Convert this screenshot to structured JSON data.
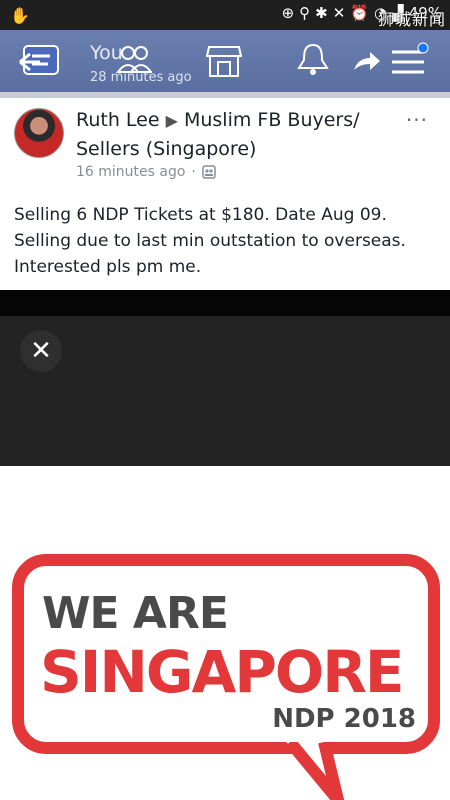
{
  "statusbar": {
    "battery": "49%",
    "watermark": "狮城新闻"
  },
  "topbar": {
    "title": "You",
    "subtitle": "28 minutes ago"
  },
  "post": {
    "author": "Ruth Lee",
    "group": "Muslim FB Buyers/ Sellers (Singapore)",
    "time": "16 minutes ago",
    "more": "···",
    "text": "Selling 6 NDP Tickets at $180. Date Aug 09. Selling due to last min outstation to overseas. Interested pls pm me."
  },
  "banner": {
    "line1": "WE ARE",
    "line2": "SINGAPORE",
    "line3": "NDP 2018"
  },
  "colors": {
    "fb_blue": "#5a6f9f",
    "ndp_red": "#e2383a"
  }
}
